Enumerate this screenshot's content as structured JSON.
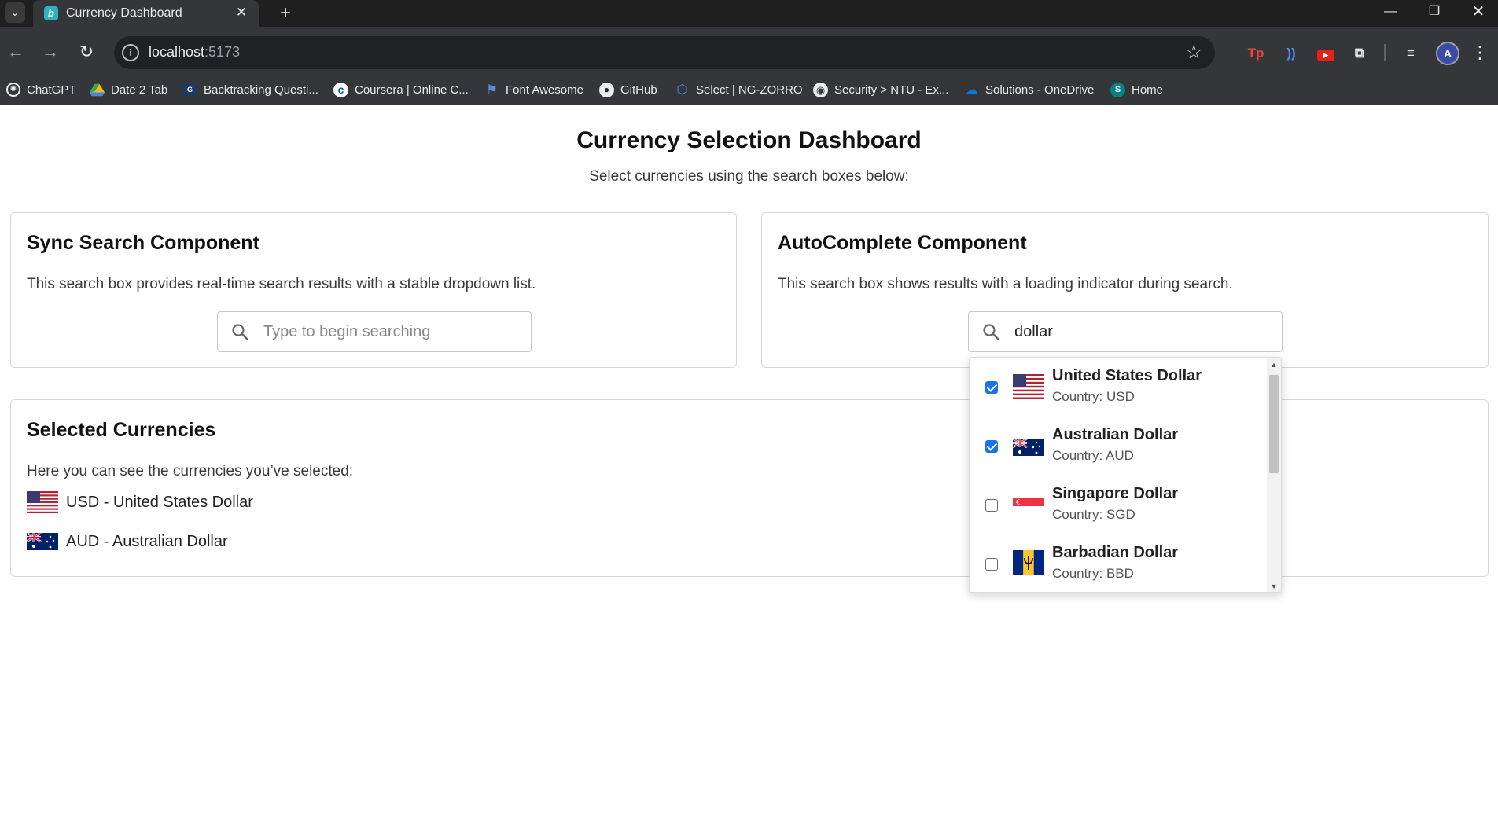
{
  "browser": {
    "tab_title": "Currency Dashboard",
    "tab_close": "✕",
    "new_tab": "+",
    "url_host": "localhost",
    "url_port": ":5173",
    "bookmarks": [
      {
        "label": "ChatGPT",
        "icon": "chatgpt-icon",
        "color": "#ffffff"
      },
      {
        "label": "Date 2 Tab",
        "icon": "google-drive-icon",
        "color": "#34a853"
      },
      {
        "label": "Backtracking Questi...",
        "icon": "geeksforgeeks-icon",
        "color": "#2f8d46"
      },
      {
        "label": "Coursera | Online C...",
        "icon": "coursera-icon",
        "color": "#0056d2"
      },
      {
        "label": "Font Awesome",
        "icon": "flag-icon",
        "color": "#538dd7"
      },
      {
        "label": "GitHub",
        "icon": "github-icon",
        "color": "#ffffff"
      },
      {
        "label": "Select | NG-ZORRO",
        "icon": "ng-zorro-icon",
        "color": "#4d8cf5"
      },
      {
        "label": "Security > NTU - Ex...",
        "icon": "globe-icon",
        "color": "#e8eaed"
      },
      {
        "label": "Solutions - OneDrive",
        "icon": "onedrive-icon",
        "color": "#0a78d4"
      },
      {
        "label": "Home",
        "icon": "sharepoint-icon",
        "color": "#038387"
      }
    ]
  },
  "page": {
    "title": "Currency Selection Dashboard",
    "subtitle": "Select currencies using the search boxes below:"
  },
  "sync_card": {
    "title": "Sync Search Component",
    "description": "This search box provides real-time search results with a stable dropdown list.",
    "placeholder": "Type to begin searching",
    "value": ""
  },
  "auto_card": {
    "title": "AutoComplete Component",
    "description": "This search box shows results with a loading indicator during search.",
    "value": "dollar"
  },
  "selected_card": {
    "title": "Selected Currencies",
    "description": "Here you can see the currencies you’ve selected:",
    "items": [
      {
        "text": "USD - United States Dollar",
        "flag": "us-flag"
      },
      {
        "text": "AUD - Australian Dollar",
        "flag": "au-flag"
      }
    ]
  },
  "dropdown": {
    "items": [
      {
        "name": "United States Dollar",
        "country": "Country: USD",
        "checked": true,
        "flag": "us-flag"
      },
      {
        "name": "Australian Dollar",
        "country": "Country: AUD",
        "checked": true,
        "flag": "au-flag"
      },
      {
        "name": "Singapore Dollar",
        "country": "Country: SGD",
        "checked": false,
        "flag": "sg-flag"
      },
      {
        "name": "Barbadian Dollar",
        "country": "Country: BBD",
        "checked": false,
        "flag": "bb-flag"
      }
    ]
  },
  "colors": {
    "accent": "#1a73e8",
    "chrome_dark": "#1f1f1f",
    "chrome_toolbar": "#35363a"
  }
}
